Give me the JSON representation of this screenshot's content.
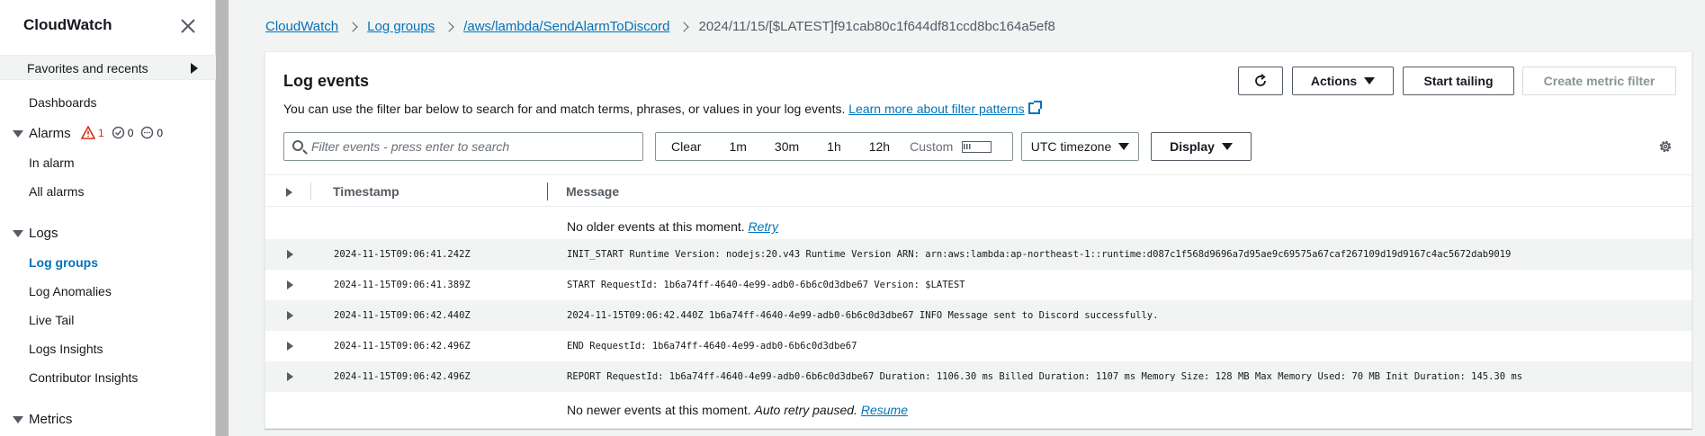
{
  "sidebar": {
    "title": "CloudWatch",
    "favorites_label": "Favorites and recents",
    "dashboards": "Dashboards",
    "alarms": {
      "label": "Alarms",
      "in_alarm_count": "1",
      "ok_count": "0",
      "insufficient_count": "0",
      "items": [
        "In alarm",
        "All alarms"
      ]
    },
    "logs": {
      "label": "Logs",
      "items": [
        "Log groups",
        "Log Anomalies",
        "Live Tail",
        "Logs Insights",
        "Contributor Insights"
      ]
    },
    "metrics_label": "Metrics"
  },
  "breadcrumb": {
    "items": [
      "CloudWatch",
      "Log groups",
      "/aws/lambda/SendAlarmToDiscord"
    ],
    "current": "2024/11/15/[$LATEST]f91cab80c1f644df81ccd8bc164a5ef8"
  },
  "panel": {
    "title": "Log events",
    "description": "You can use the filter bar below to search for and match terms, phrases, or values in your log events.",
    "learn_more": "Learn more about filter patterns",
    "buttons": {
      "actions": "Actions",
      "start_tailing": "Start tailing",
      "create_metric_filter": "Create metric filter"
    },
    "search_placeholder": "Filter events - press enter to search",
    "range": {
      "clear": "Clear",
      "options": [
        "1m",
        "30m",
        "1h",
        "12h"
      ],
      "custom": "Custom"
    },
    "timezone": "UTC timezone",
    "display": "Display"
  },
  "table": {
    "headers": {
      "timestamp": "Timestamp",
      "message": "Message"
    },
    "top_notice": {
      "text": "No older events at this moment.",
      "link": "Retry"
    },
    "rows": [
      {
        "ts": "2024-11-15T09:06:41.242Z",
        "msg": "INIT_START Runtime Version: nodejs:20.v43 Runtime Version ARN: arn:aws:lambda:ap-northeast-1::runtime:d087c1f568d9696a7d95ae9c69575a67caf267109d19d9167c4ac5672dab9019"
      },
      {
        "ts": "2024-11-15T09:06:41.389Z",
        "msg": "START RequestId: 1b6a74ff-4640-4e99-adb0-6b6c0d3dbe67 Version: $LATEST"
      },
      {
        "ts": "2024-11-15T09:06:42.440Z",
        "msg": "2024-11-15T09:06:42.440Z 1b6a74ff-4640-4e99-adb0-6b6c0d3dbe67 INFO Message sent to Discord successfully."
      },
      {
        "ts": "2024-11-15T09:06:42.496Z",
        "msg": "END RequestId: 1b6a74ff-4640-4e99-adb0-6b6c0d3dbe67"
      },
      {
        "ts": "2024-11-15T09:06:42.496Z",
        "msg": "REPORT RequestId: 1b6a74ff-4640-4e99-adb0-6b6c0d3dbe67 Duration: 1106.30 ms Billed Duration: 1107 ms Memory Size: 128 MB Max Memory Used: 70 MB Init Duration: 145.30 ms"
      }
    ],
    "bottom_notice": {
      "text": "No newer events at this moment.",
      "italic": "Auto retry paused.",
      "link": "Resume"
    }
  },
  "colors": {
    "link": "#0073bb",
    "alarm": "#d13212",
    "row_alt": "#f2f3f3"
  }
}
